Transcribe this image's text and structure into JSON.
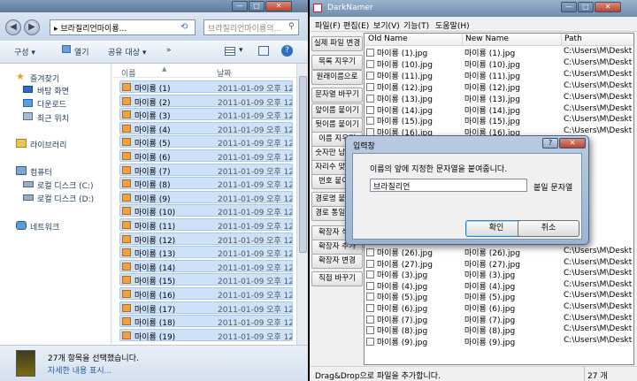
{
  "explorer": {
    "window_controls": {
      "minimize": "—",
      "maximize": "□",
      "close": "✕"
    },
    "address": "▸ 브라질리언마이룡...",
    "search_placeholder": "브라질리언마이룡의...",
    "toolbar": {
      "organize": "구성 ▾",
      "open": "열기",
      "share": "공유 대상 ▾",
      "more": "»"
    },
    "nav": {
      "favorites": "즐겨찾기",
      "desktop": "바탕 화면",
      "downloads": "다운로드",
      "recent": "최근 위치",
      "libraries": "라이브러리",
      "computer": "컴퓨터",
      "disk_c": "로컬 디스크 (C:)",
      "disk_d": "로컬 디스크 (D:)",
      "network": "네트워크"
    },
    "columns": {
      "name": "이름",
      "date": "날짜"
    },
    "files": [
      {
        "name": "마이룡 (1)",
        "date": "2011-01-09 오후 12:"
      },
      {
        "name": "마이룡 (2)",
        "date": "2011-01-09 오후 12:"
      },
      {
        "name": "마이룡 (3)",
        "date": "2011-01-09 오후 12:"
      },
      {
        "name": "마이룡 (4)",
        "date": "2011-01-09 오후 12:"
      },
      {
        "name": "마이룡 (5)",
        "date": "2011-01-09 오후 12:"
      },
      {
        "name": "마이룡 (6)",
        "date": "2011-01-09 오후 12:"
      },
      {
        "name": "마이룡 (7)",
        "date": "2011-01-09 오후 12:"
      },
      {
        "name": "마이룡 (8)",
        "date": "2011-01-09 오후 12:"
      },
      {
        "name": "마이룡 (9)",
        "date": "2011-01-09 오후 12:"
      },
      {
        "name": "마이룡 (10)",
        "date": "2011-01-09 오후 12:"
      },
      {
        "name": "마이룡 (11)",
        "date": "2011-01-09 오후 12:"
      },
      {
        "name": "마이룡 (12)",
        "date": "2011-01-09 오후 12:"
      },
      {
        "name": "마이룡 (13)",
        "date": "2011-01-09 오후 12:"
      },
      {
        "name": "마이룡 (14)",
        "date": "2011-01-09 오후 12:"
      },
      {
        "name": "마이룡 (15)",
        "date": "2011-01-09 오후 12:"
      },
      {
        "name": "마이룡 (16)",
        "date": "2011-01-09 오후 12:"
      },
      {
        "name": "마이룡 (17)",
        "date": "2011-01-09 오후 12:"
      },
      {
        "name": "마이룡 (18)",
        "date": "2011-01-09 오후 12:"
      },
      {
        "name": "마이룡 (19)",
        "date": "2011-01-09 오후 12:"
      }
    ],
    "detail": {
      "count": "27개 항목을 선택했습니다.",
      "more": "자세한 내용 표시..."
    }
  },
  "darknamer": {
    "title": "DarkNamer",
    "window_controls": {
      "minimize": "—",
      "maximize": "□",
      "close": "✕"
    },
    "menu": [
      "파일(F)",
      "편집(E)",
      "보기(V)",
      "기능(T)",
      "도움말(H)"
    ],
    "side_buttons": [
      "실제 파일 변경",
      "목록 지우기",
      "원래이름으로",
      "문자열 바꾸기",
      "앞이름 붙이기",
      "뒷이름 붙이기",
      "이름 지우기",
      "숫자만 남기기",
      "자리수 맞추기",
      "번호 붙이기",
      "경로명 붙이기",
      "경로 통일하기",
      "확장자 삭제",
      "확장자 추가",
      "확장자 변경",
      "직접 바꾸기"
    ],
    "columns": {
      "old": "Old Name",
      "new": "New Name",
      "path": "Path"
    },
    "rows_top": [
      {
        "old": "마이룡 (1).jpg",
        "new": "마이룡 (1).jpg",
        "path": "C:\\Users\\M\\Deskt"
      },
      {
        "old": "마이룡 (10).jpg",
        "new": "마이룡 (10).jpg",
        "path": "C:\\Users\\M\\Deskt"
      },
      {
        "old": "마이룡 (11).jpg",
        "new": "마이룡 (11).jpg",
        "path": "C:\\Users\\M\\Deskt"
      },
      {
        "old": "마이룡 (12).jpg",
        "new": "마이룡 (12).jpg",
        "path": "C:\\Users\\M\\Deskt"
      },
      {
        "old": "마이룡 (13).jpg",
        "new": "마이룡 (13).jpg",
        "path": "C:\\Users\\M\\Deskt"
      },
      {
        "old": "마이룡 (14).jpg",
        "new": "마이룡 (14).jpg",
        "path": "C:\\Users\\M\\Deskt"
      },
      {
        "old": "마이룡 (15).jpg",
        "new": "마이룡 (15).jpg",
        "path": "C:\\Users\\M\\Deskt"
      },
      {
        "old": "마이룡 (16).jpg",
        "new": "마이룡 (16).jpg",
        "path": "C:\\Users\\M\\Deskt"
      }
    ],
    "rows_bottom": [
      {
        "old": "마이룡 (26).jpg",
        "new": "마이룡 (26).jpg",
        "path": "C:\\Users\\M\\Deskt"
      },
      {
        "old": "마이룡 (27).jpg",
        "new": "마이룡 (27).jpg",
        "path": "C:\\Users\\M\\Deskt"
      },
      {
        "old": "마이룡 (3).jpg",
        "new": "마이룡 (3).jpg",
        "path": "C:\\Users\\M\\Deskt"
      },
      {
        "old": "마이룡 (4).jpg",
        "new": "마이룡 (4).jpg",
        "path": "C:\\Users\\M\\Deskt"
      },
      {
        "old": "마이룡 (5).jpg",
        "new": "마이룡 (5).jpg",
        "path": "C:\\Users\\M\\Deskt"
      },
      {
        "old": "마이룡 (6).jpg",
        "new": "마이룡 (6).jpg",
        "path": "C:\\Users\\M\\Deskt"
      },
      {
        "old": "마이룡 (7).jpg",
        "new": "마이룡 (7).jpg",
        "path": "C:\\Users\\M\\Deskt"
      },
      {
        "old": "마이룡 (8).jpg",
        "new": "마이룡 (8).jpg",
        "path": "C:\\Users\\M\\Deskt"
      },
      {
        "old": "마이룡 (9).jpg",
        "new": "마이룡 (9).jpg",
        "path": "C:\\Users\\M\\Deskt"
      }
    ],
    "status_left": "Drag&Drop으로 파일을 추가합니다.",
    "status_right": "27 개"
  },
  "dialog": {
    "title": "입력창",
    "help": "?",
    "close": "✕",
    "prompt": "이름의 앞에 지정한 문자열을 붙여줍니다.",
    "input_value": "브라질리언",
    "suffix_label": "붙일 문자열",
    "ok": "확인",
    "cancel": "취소"
  }
}
